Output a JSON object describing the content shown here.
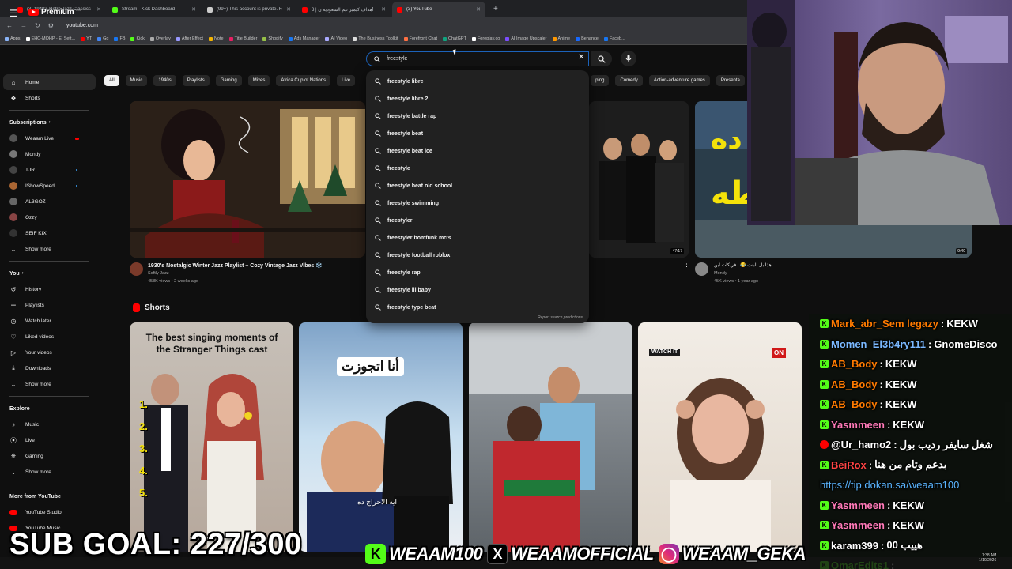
{
  "browser": {
    "tabs": [
      {
        "label": "(3) 1940's Retro Jazz Classics - Y",
        "color": "#ff0000",
        "active": false
      },
      {
        "label": "Stream - Kick Dashboard",
        "color": "#53fc18",
        "active": false
      },
      {
        "label": "(99+) This account is private. Fo",
        "color": "#cccccc",
        "active": false
      },
      {
        "label": "أهداف كيمبر تيم السعودية ن | 3",
        "color": "#ff0000",
        "active": false
      },
      {
        "label": "(3) YouTube",
        "color": "#ff0000",
        "active": true
      }
    ],
    "new_tab": "+",
    "url": "youtube.com",
    "bookmarks": [
      {
        "label": "Apps",
        "color": "#8ab4f8"
      },
      {
        "label": "EHC-MOHP - El Sett...",
        "color": "#ffffff"
      },
      {
        "label": "YT",
        "color": "#ff0000"
      },
      {
        "label": "Gg",
        "color": "#4285f4"
      },
      {
        "label": "FB",
        "color": "#1877f2"
      },
      {
        "label": "Kick",
        "color": "#53fc18"
      },
      {
        "label": "Overlay",
        "color": "#aaaaaa"
      },
      {
        "label": "After Effect",
        "color": "#9999ff"
      },
      {
        "label": "Note",
        "color": "#f4b400"
      },
      {
        "label": "Title Builder",
        "color": "#e91e63"
      },
      {
        "label": "Shopify",
        "color": "#95bf47"
      },
      {
        "label": "Ads Manager",
        "color": "#1877f2"
      },
      {
        "label": "AI Video",
        "color": "#aaaaff"
      },
      {
        "label": "The Business Toolkit",
        "color": "#dddddd"
      },
      {
        "label": "Forefront Chat",
        "color": "#ff7043"
      },
      {
        "label": "ChatGPT",
        "color": "#10a37f"
      },
      {
        "label": "Foreplay.co",
        "color": "#ffffff"
      },
      {
        "label": "AI Image Upscaler",
        "color": "#7c4dff"
      },
      {
        "label": "Anime",
        "color": "#ff9800"
      },
      {
        "label": "Behance",
        "color": "#1769ff"
      },
      {
        "label": "Faceb...",
        "color": "#1877f2"
      }
    ]
  },
  "youtube": {
    "logo_text": "Premium",
    "country_code": "EG",
    "search": {
      "value": "freestyle",
      "suggestions": [
        "freestyle libre",
        "freestyle libre 2",
        "freestyle battle rap",
        "freestyle beat",
        "freestyle beat ice",
        "freestyle",
        "freestyle beat old school",
        "freestyle swimming",
        "freestyler",
        "freestyler bomfunk mc's",
        "freestyle football roblox",
        "freestyle rap",
        "freestyle lil baby",
        "freestyle type beat"
      ],
      "report": "Report search predictions"
    },
    "chips": [
      "All",
      "Music",
      "1940s",
      "Playlists",
      "Gaming",
      "Mixes",
      "Africa Cup of Nations",
      "Live",
      "ping",
      "Comedy",
      "Action-adventure games",
      "Presenta"
    ],
    "sidebar": {
      "home": "Home",
      "shorts": "Shorts",
      "subscriptions_head": "Subscriptions",
      "subscriptions": [
        {
          "label": "Weaam Live",
          "color": "#555555",
          "badge": "live"
        },
        {
          "label": "Mondy",
          "color": "#777777",
          "badge": ""
        },
        {
          "label": "TJR",
          "color": "#444444",
          "badge": "dot"
        },
        {
          "label": "IShowSpeed",
          "color": "#aa6633",
          "badge": "dot"
        },
        {
          "label": "AL3GOZ",
          "color": "#666666",
          "badge": ""
        },
        {
          "label": "Ozzy",
          "color": "#884444",
          "badge": ""
        },
        {
          "label": "SEIF KIX",
          "color": "#333333",
          "badge": ""
        }
      ],
      "show_more": "Show more",
      "you_head": "You",
      "you_items": [
        "History",
        "Playlists",
        "Watch later",
        "Liked videos",
        "Your videos",
        "Downloads",
        "Show more"
      ],
      "explore_head": "Explore",
      "explore_items": [
        "Music",
        "Live",
        "Gaming",
        "Show more"
      ],
      "more_head": "More from YouTube",
      "more_items": [
        "YouTube Studio",
        "YouTube Music"
      ]
    },
    "videos": [
      {
        "title": "1930's Nostalgic Winter Jazz Playlist – Cozy Vintage Jazz Vibes ❄️",
        "channel": "Softly Jazz",
        "meta": "458K views • 2 weeks ago"
      },
      {
        "title": "",
        "channel": "",
        "meta": "",
        "duration": "47:17"
      },
      {
        "title": "هذا بل البنت 😂 | فريكات ابن...",
        "channel": "Mondy",
        "meta": "45K views • 1 year ago",
        "duration": "9:40"
      }
    ],
    "shorts_head": "Shorts",
    "shorts": [
      {
        "caption": "The best singing moments of the Stranger Things cast",
        "numbers": [
          "1.",
          "2.",
          "3.",
          "4.",
          "5."
        ]
      },
      {
        "caption": "أنا اتجوزت",
        "sub": "ايه الاحراج ده"
      },
      {
        "caption": ""
      },
      {
        "caption": "WATCH IT",
        "badge": "ON"
      }
    ]
  },
  "chat": [
    {
      "user": "Mark_abr_Sem legazy",
      "msg": "KEKW",
      "color": "#ff7a00",
      "badge": "k"
    },
    {
      "user": "Momen_El3b4ry111",
      "msg": "GnomeDisco",
      "color": "#7ab8ff",
      "badge": "k"
    },
    {
      "user": "AB_Body",
      "msg": "KEKW",
      "color": "#ff7a00",
      "badge": "k"
    },
    {
      "user": "AB_Body",
      "msg": "KEKW",
      "color": "#ff7a00",
      "badge": "k"
    },
    {
      "user": "AB_Body",
      "msg": "KEKW",
      "color": "#ff7a00",
      "badge": "k"
    },
    {
      "user": "Yasmmeen",
      "msg": "KEKW",
      "color": "#ff7ab8",
      "badge": "k"
    },
    {
      "user": "@Ur_hamo2",
      "msg": "شغل سايفر رديب بول",
      "color": "#ffffff",
      "badge": "y"
    },
    {
      "user": "BeiRox",
      "msg": "بدعم وتام من هنا",
      "color": "#ff4444",
      "badge": "k"
    },
    {
      "user": "",
      "msg": "https://tip.dokan.sa/weaam100",
      "color": "#5ab4ff",
      "badge": ""
    },
    {
      "user": "Yasmmeen",
      "msg": "KEKW",
      "color": "#ff7ab8",
      "badge": "k"
    },
    {
      "user": "Yasmmeen",
      "msg": "KEKW",
      "color": "#ff7ab8",
      "badge": "k"
    },
    {
      "user": "karam399",
      "msg": "هييب 00",
      "color": "#ffffff",
      "badge": "k"
    },
    {
      "user": "OmarEdits1",
      "msg": "",
      "color": "#53fc18",
      "badge": "k"
    }
  ],
  "overlay": {
    "sub_goal": "SUB GOAL: 227/300",
    "kick": "WEAAM100",
    "x": "WEAAMOFFICIAL",
    "instagram": "WEAAM_GEKA"
  },
  "clock": {
    "time": "1:38 AM",
    "date": "1/10/2026"
  }
}
